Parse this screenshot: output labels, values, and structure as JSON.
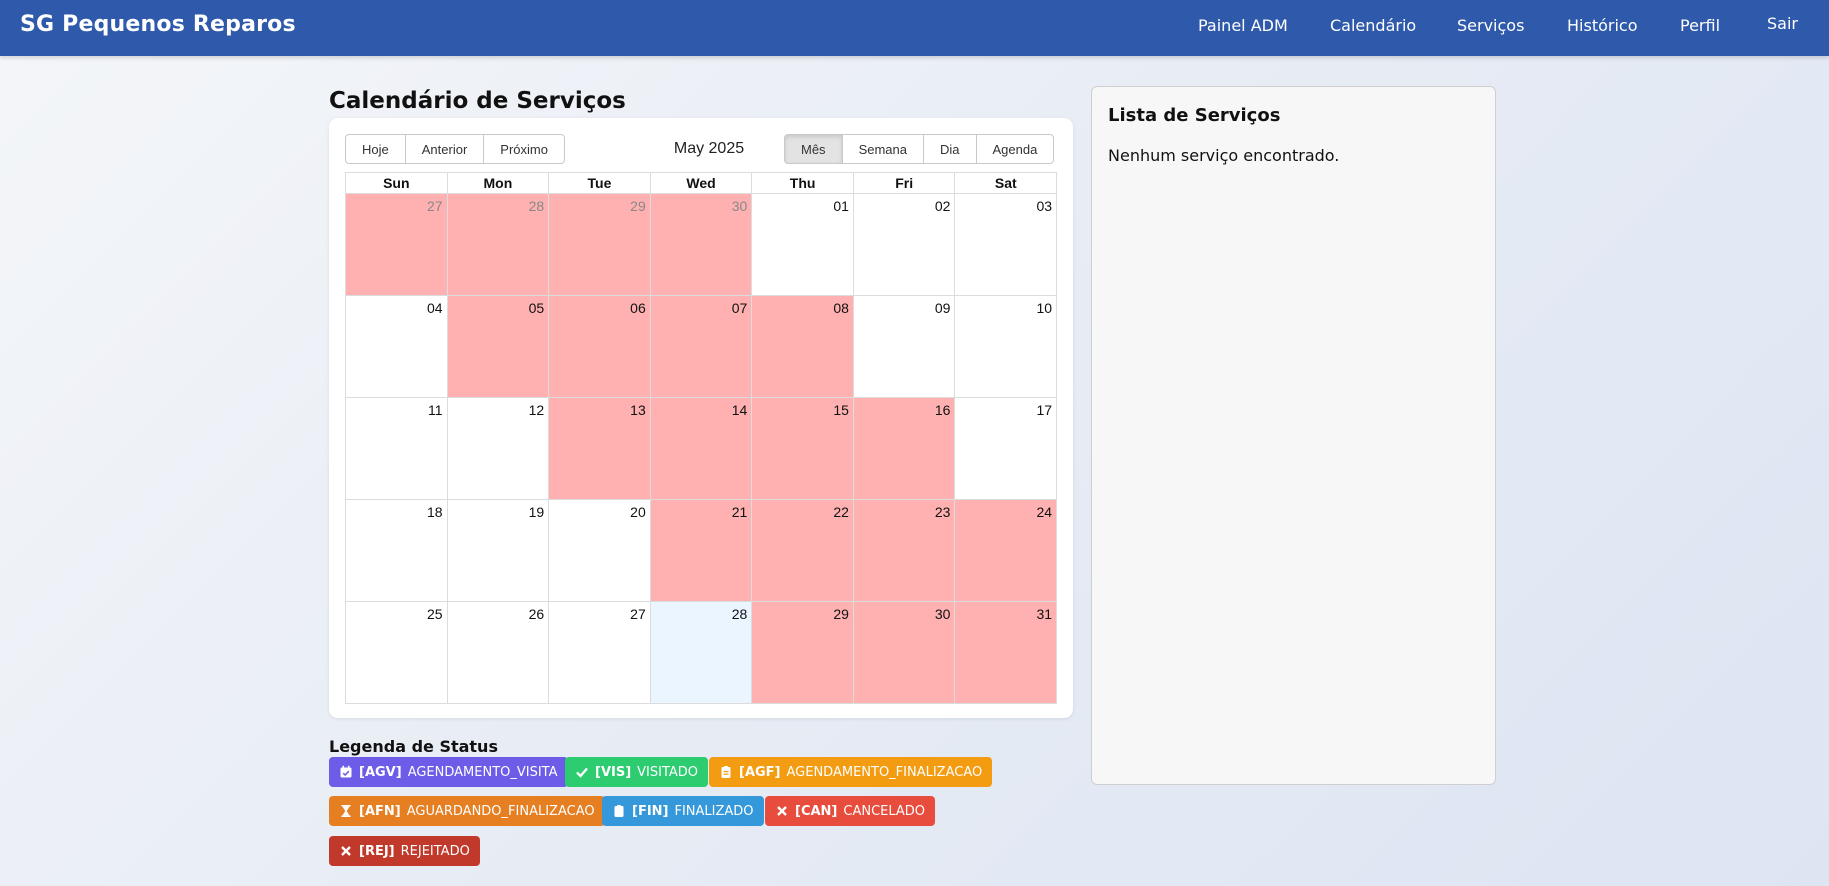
{
  "app": {
    "brand": "SG Pequenos Reparos"
  },
  "nav": {
    "painel": "Painel ADM",
    "calendario": "Calendário",
    "servicos": "Serviços",
    "historico": "Histórico",
    "perfil": "Perfil",
    "sair": "Sair"
  },
  "page": {
    "title": "Calendário de Serviços"
  },
  "calendar": {
    "toolbar": {
      "today": "Hoje",
      "prev": "Anterior",
      "next": "Próximo",
      "label": "May 2025",
      "views": [
        "Mês",
        "Semana",
        "Dia",
        "Agenda"
      ],
      "active_view": "Mês"
    },
    "weekdays": [
      "Sun",
      "Mon",
      "Tue",
      "Wed",
      "Thu",
      "Fri",
      "Sat"
    ],
    "weeks": [
      [
        {
          "d": "27",
          "busy": true,
          "off": true
        },
        {
          "d": "28",
          "busy": true,
          "off": true
        },
        {
          "d": "29",
          "busy": true,
          "off": true
        },
        {
          "d": "30",
          "busy": true,
          "off": true
        },
        {
          "d": "01"
        },
        {
          "d": "02"
        },
        {
          "d": "03"
        }
      ],
      [
        {
          "d": "04"
        },
        {
          "d": "05",
          "busy": true
        },
        {
          "d": "06",
          "busy": true
        },
        {
          "d": "07",
          "busy": true
        },
        {
          "d": "08",
          "busy": true
        },
        {
          "d": "09"
        },
        {
          "d": "10"
        }
      ],
      [
        {
          "d": "11"
        },
        {
          "d": "12"
        },
        {
          "d": "13",
          "busy": true
        },
        {
          "d": "14",
          "busy": true
        },
        {
          "d": "15",
          "busy": true
        },
        {
          "d": "16",
          "busy": true
        },
        {
          "d": "17"
        }
      ],
      [
        {
          "d": "18"
        },
        {
          "d": "19"
        },
        {
          "d": "20"
        },
        {
          "d": "21",
          "busy": true
        },
        {
          "d": "22",
          "busy": true
        },
        {
          "d": "23",
          "busy": true
        },
        {
          "d": "24",
          "busy": true
        }
      ],
      [
        {
          "d": "25"
        },
        {
          "d": "26"
        },
        {
          "d": "27"
        },
        {
          "d": "28",
          "today": true
        },
        {
          "d": "29",
          "busy": true
        },
        {
          "d": "30",
          "busy": true
        },
        {
          "d": "31",
          "busy": true
        }
      ]
    ]
  },
  "side": {
    "title": "Lista de Serviços",
    "empty": "Nenhum serviço encontrado."
  },
  "legend": {
    "title": "Legenda de Status",
    "items": [
      {
        "code": "[AGV]",
        "label": "AGENDAMENTO_VISITA",
        "color": "#6c5ce7",
        "icon": "calendar-check-icon"
      },
      {
        "code": "[VIS]",
        "label": "VISITADO",
        "color": "#2ecc71",
        "icon": "check-icon"
      },
      {
        "code": "[AGF]",
        "label": "AGENDAMENTO_FINALIZACAO",
        "color": "#f39c12",
        "icon": "clipboard-list-icon"
      },
      {
        "code": "[AFN]",
        "label": "AGUARDANDO_FINALIZACAO",
        "color": "#e67e22",
        "icon": "hourglass-icon"
      },
      {
        "code": "[FIN]",
        "label": "FINALIZADO",
        "color": "#3498db",
        "icon": "clipboard-icon"
      },
      {
        "code": "[CAN]",
        "label": "CANCELADO",
        "color": "#e74c3c",
        "icon": "close-icon"
      },
      {
        "code": "[REJ]",
        "label": "REJEITADO",
        "color": "#c0392b",
        "icon": "close-icon"
      }
    ]
  }
}
